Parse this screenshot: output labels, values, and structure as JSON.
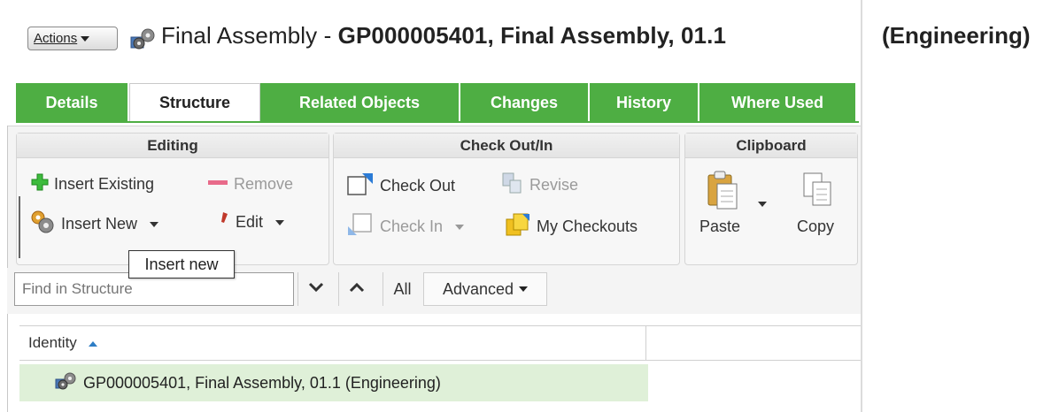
{
  "header": {
    "actions_label": "Actions",
    "title_plain": "Final Assembly - ",
    "title_bold": "GP000005401, Final Assembly, 01.1",
    "title_extra": "(Engineering)"
  },
  "tabs": [
    {
      "label": "Details",
      "active": false
    },
    {
      "label": "Structure",
      "active": true
    },
    {
      "label": "Related Objects",
      "active": false
    },
    {
      "label": "Changes",
      "active": false
    },
    {
      "label": "History",
      "active": false
    },
    {
      "label": "Where Used",
      "active": false
    }
  ],
  "ribbon": {
    "editing": {
      "title": "Editing",
      "insert_existing": "Insert Existing",
      "remove": "Remove",
      "insert_new": "Insert New",
      "edit": "Edit"
    },
    "checkout": {
      "title": "Check Out/In",
      "check_out": "Check Out",
      "revise": "Revise",
      "check_in": "Check In",
      "my_checkouts": "My Checkouts"
    },
    "clipboard": {
      "title": "Clipboard",
      "paste": "Paste",
      "copy": "Copy"
    }
  },
  "tooltip": "Insert new",
  "find": {
    "placeholder": "Find in Structure",
    "all": "All",
    "advanced": "Advanced"
  },
  "table": {
    "column_identity": "Identity",
    "rows": [
      {
        "identity": "GP000005401, Final Assembly, 01.1 (Engineering)"
      }
    ]
  },
  "colors": {
    "tab_green": "#4eae43",
    "row_highlight": "#dff0d8",
    "sort_arrow": "#2e7dc5"
  }
}
